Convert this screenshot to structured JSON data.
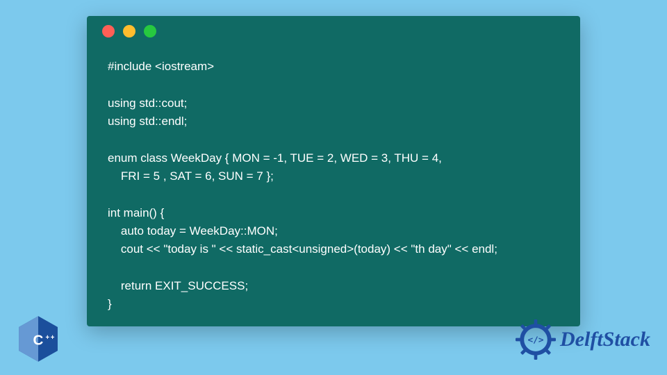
{
  "code_window": {
    "dots": [
      "red",
      "yellow",
      "green"
    ],
    "lines": [
      "#include <iostream>",
      "",
      "using std::cout;",
      "using std::endl;",
      "",
      "enum class WeekDay { MON = -1, TUE = 2, WED = 3, THU = 4,",
      "    FRI = 5 , SAT = 6, SUN = 7 };",
      "",
      "int main() {",
      "    auto today = WeekDay::MON;",
      "    cout << \"today is \" << static_cast<unsigned>(today) << \"th day\" << endl;",
      "",
      "    return EXIT_SUCCESS;",
      "}"
    ]
  },
  "cpp_badge": {
    "label": "C++"
  },
  "brand": {
    "name": "DelftStack",
    "icon_glyph": "</>"
  },
  "colors": {
    "page_bg": "#7cc9ed",
    "window_bg": "#106a64",
    "code_text": "#ffffff",
    "cpp_blue_light": "#6699d4",
    "cpp_blue_dark": "#1b4f9c",
    "brand_blue": "#1f4fa3"
  }
}
